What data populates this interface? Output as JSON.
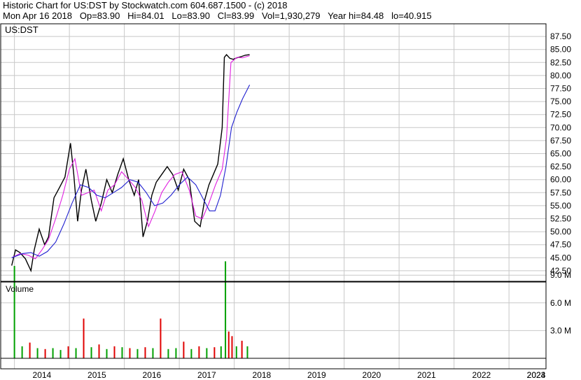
{
  "header": {
    "line1": "Historic Chart for US:DST by Stockwatch.com 604.687.1500 - (c) 2018",
    "line2": "Mon Apr 16 2018   Op=83.90   Hi=84.01   Lo=83.90   Cl=83.99   Vol=1,930,279   Year hi=84.48   lo=40.915"
  },
  "chart_data": [
    {
      "type": "line",
      "title": "US:DST",
      "ylim": [
        40.0,
        89.5
      ],
      "y_ticks": [
        "87.50",
        "85.00",
        "82.50",
        "80.00",
        "77.50",
        "75.00",
        "72.50",
        "70.00",
        "67.50",
        "65.00",
        "62.50",
        "60.00",
        "57.50",
        "55.00",
        "52.50",
        "50.00",
        "47.50",
        "45.00",
        "42.50"
      ],
      "x_labels": [
        "2014",
        "2015",
        "2016",
        "2017",
        "2018",
        "2019",
        "2020",
        "2021",
        "2022",
        "2023",
        "2024"
      ],
      "grid": true,
      "series": [
        {
          "name": "price",
          "color": "#000000",
          "x": [
            2013.95,
            2014.02,
            2014.1,
            2014.2,
            2014.3,
            2014.36,
            2014.45,
            2014.55,
            2014.62,
            2014.72,
            2014.82,
            2014.92,
            2015.02,
            2015.08,
            2015.15,
            2015.22,
            2015.3,
            2015.4,
            2015.48,
            2015.58,
            2015.68,
            2015.78,
            2015.88,
            2015.98,
            2016.08,
            2016.18,
            2016.26,
            2016.34,
            2016.42,
            2016.5,
            2016.58,
            2016.68,
            2016.78,
            2016.88,
            2016.98,
            2017.08,
            2017.18,
            2017.28,
            2017.38,
            2017.46,
            2017.54,
            2017.62,
            2017.7,
            2017.78,
            2017.82,
            2017.86,
            2017.92,
            2017.98,
            2018.05,
            2018.12,
            2018.2,
            2018.28
          ],
          "values": [
            43.5,
            46.5,
            46.0,
            44.8,
            42.5,
            46.5,
            50.5,
            47.5,
            49.0,
            56.5,
            58.5,
            60.5,
            67.0,
            61.0,
            52.0,
            58.0,
            62.0,
            56.0,
            52.0,
            55.5,
            60.0,
            57.5,
            61.0,
            64.0,
            60.0,
            57.0,
            60.0,
            49.0,
            52.0,
            57.0,
            59.5,
            61.0,
            62.5,
            61.0,
            58.0,
            62.0,
            60.0,
            52.0,
            51.0,
            56.0,
            59.0,
            61.0,
            63.0,
            70.0,
            83.5,
            84.0,
            83.3,
            83.1,
            83.4,
            83.6,
            83.9,
            84.0
          ]
        },
        {
          "name": "ma-short",
          "color": "#e020e0",
          "x": [
            2013.95,
            2014.1,
            2014.25,
            2014.38,
            2014.5,
            2014.62,
            2014.75,
            2014.88,
            2015.0,
            2015.1,
            2015.22,
            2015.34,
            2015.45,
            2015.58,
            2015.7,
            2015.82,
            2015.95,
            2016.08,
            2016.2,
            2016.32,
            2016.44,
            2016.56,
            2016.68,
            2016.8,
            2016.92,
            2017.05,
            2017.18,
            2017.3,
            2017.42,
            2017.54,
            2017.66,
            2017.78,
            2017.86,
            2017.94,
            2018.05,
            2018.15,
            2018.28
          ],
          "values": [
            45.0,
            45.8,
            45.5,
            44.8,
            46.5,
            48.5,
            52.5,
            57.0,
            62.0,
            64.0,
            57.0,
            57.5,
            58.0,
            54.0,
            58.0,
            59.0,
            61.5,
            60.0,
            58.5,
            56.0,
            51.0,
            54.0,
            57.5,
            59.5,
            61.0,
            61.5,
            58.0,
            53.0,
            52.5,
            55.5,
            59.0,
            62.0,
            68.0,
            82.5,
            83.5,
            83.4,
            83.8
          ]
        },
        {
          "name": "ma-long",
          "color": "#2020d0",
          "x": [
            2013.95,
            2014.15,
            2014.3,
            2014.45,
            2014.6,
            2014.75,
            2014.9,
            2015.05,
            2015.2,
            2015.35,
            2015.5,
            2015.65,
            2015.8,
            2015.95,
            2016.1,
            2016.25,
            2016.4,
            2016.55,
            2016.7,
            2016.85,
            2017.0,
            2017.15,
            2017.3,
            2017.45,
            2017.55,
            2017.65,
            2017.75,
            2017.85,
            2017.95,
            2018.05,
            2018.15,
            2018.28
          ],
          "values": [
            45.0,
            45.8,
            46.0,
            45.3,
            46.2,
            48.0,
            51.5,
            55.5,
            59.0,
            58.5,
            57.0,
            56.5,
            57.5,
            58.5,
            60.0,
            59.5,
            57.5,
            55.0,
            55.5,
            57.0,
            59.0,
            60.5,
            59.0,
            56.0,
            54.0,
            54.0,
            57.0,
            62.5,
            70.0,
            73.0,
            75.5,
            78.2
          ]
        }
      ]
    },
    {
      "type": "bar",
      "title": "Volume",
      "ylim": [
        0,
        11.0
      ],
      "y_ticks": [
        "9.0 M",
        "6.0 M",
        "3.0 M"
      ],
      "y_tick_values": [
        9.0,
        6.0,
        3.0
      ],
      "colors": {
        "up": "#00a000",
        "down": "#e00000"
      },
      "series": [
        {
          "name": "volume",
          "x": [
            2014.0,
            2014.14,
            2014.28,
            2014.42,
            2014.56,
            2014.7,
            2014.84,
            2014.98,
            2015.12,
            2015.26,
            2015.4,
            2015.54,
            2015.68,
            2015.82,
            2015.96,
            2016.1,
            2016.24,
            2016.38,
            2016.52,
            2016.66,
            2016.8,
            2016.94,
            2017.08,
            2017.22,
            2017.36,
            2017.5,
            2017.64,
            2017.76,
            2017.84,
            2017.9,
            2017.96,
            2018.04,
            2018.14,
            2018.24
          ],
          "values": [
            10.0,
            1.3,
            1.7,
            1.1,
            1.0,
            1.1,
            0.9,
            1.3,
            1.1,
            4.3,
            1.2,
            1.5,
            1.0,
            1.3,
            1.2,
            1.1,
            1.0,
            1.2,
            1.1,
            4.3,
            1.0,
            1.1,
            1.8,
            1.0,
            1.3,
            1.1,
            1.2,
            1.3,
            10.5,
            2.9,
            2.4,
            1.3,
            1.9,
            1.3
          ],
          "up": [
            true,
            true,
            false,
            true,
            false,
            true,
            true,
            false,
            true,
            false,
            true,
            false,
            true,
            false,
            true,
            false,
            true,
            false,
            true,
            false,
            true,
            true,
            false,
            true,
            false,
            true,
            false,
            true,
            true,
            false,
            false,
            true,
            false,
            true
          ]
        }
      ]
    }
  ]
}
